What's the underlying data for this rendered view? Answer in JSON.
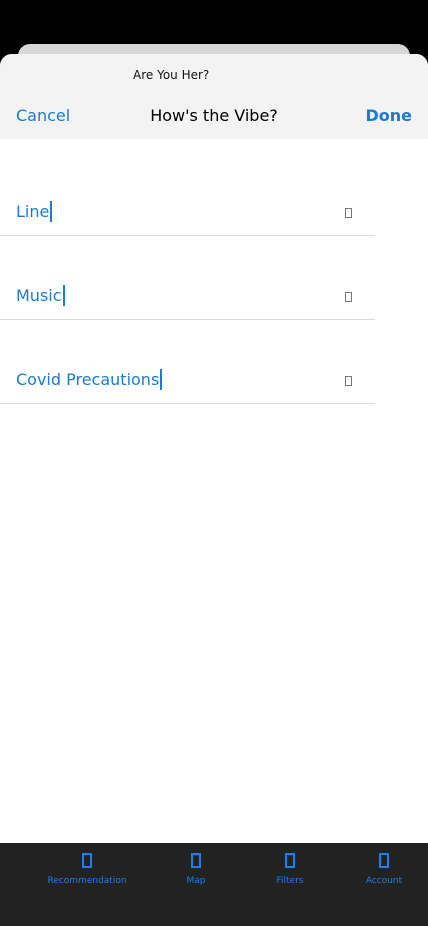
{
  "header": {
    "subtitle": "Are You Her?",
    "title": "How's the Vibe?",
    "cancel_label": "Cancel",
    "done_label": "Done"
  },
  "fields": [
    {
      "label": "Line",
      "icon": "square-outline-icon"
    },
    {
      "label": "Music",
      "icon": "square-outline-icon"
    },
    {
      "label": "Covid Precautions",
      "icon": "square-outline-icon"
    }
  ],
  "tabs": [
    {
      "label": "Recommendation",
      "icon": "tab-placeholder-icon"
    },
    {
      "label": "Map",
      "icon": "tab-placeholder-icon"
    },
    {
      "label": "Filters",
      "icon": "tab-placeholder-icon"
    },
    {
      "label": "Account",
      "icon": "tab-placeholder-icon"
    }
  ],
  "colors": {
    "accent": "#1b7bd4",
    "tab_accent": "#1a7ff0",
    "nav_background": "#f3f3f3",
    "tabbar_background": "#222222"
  }
}
